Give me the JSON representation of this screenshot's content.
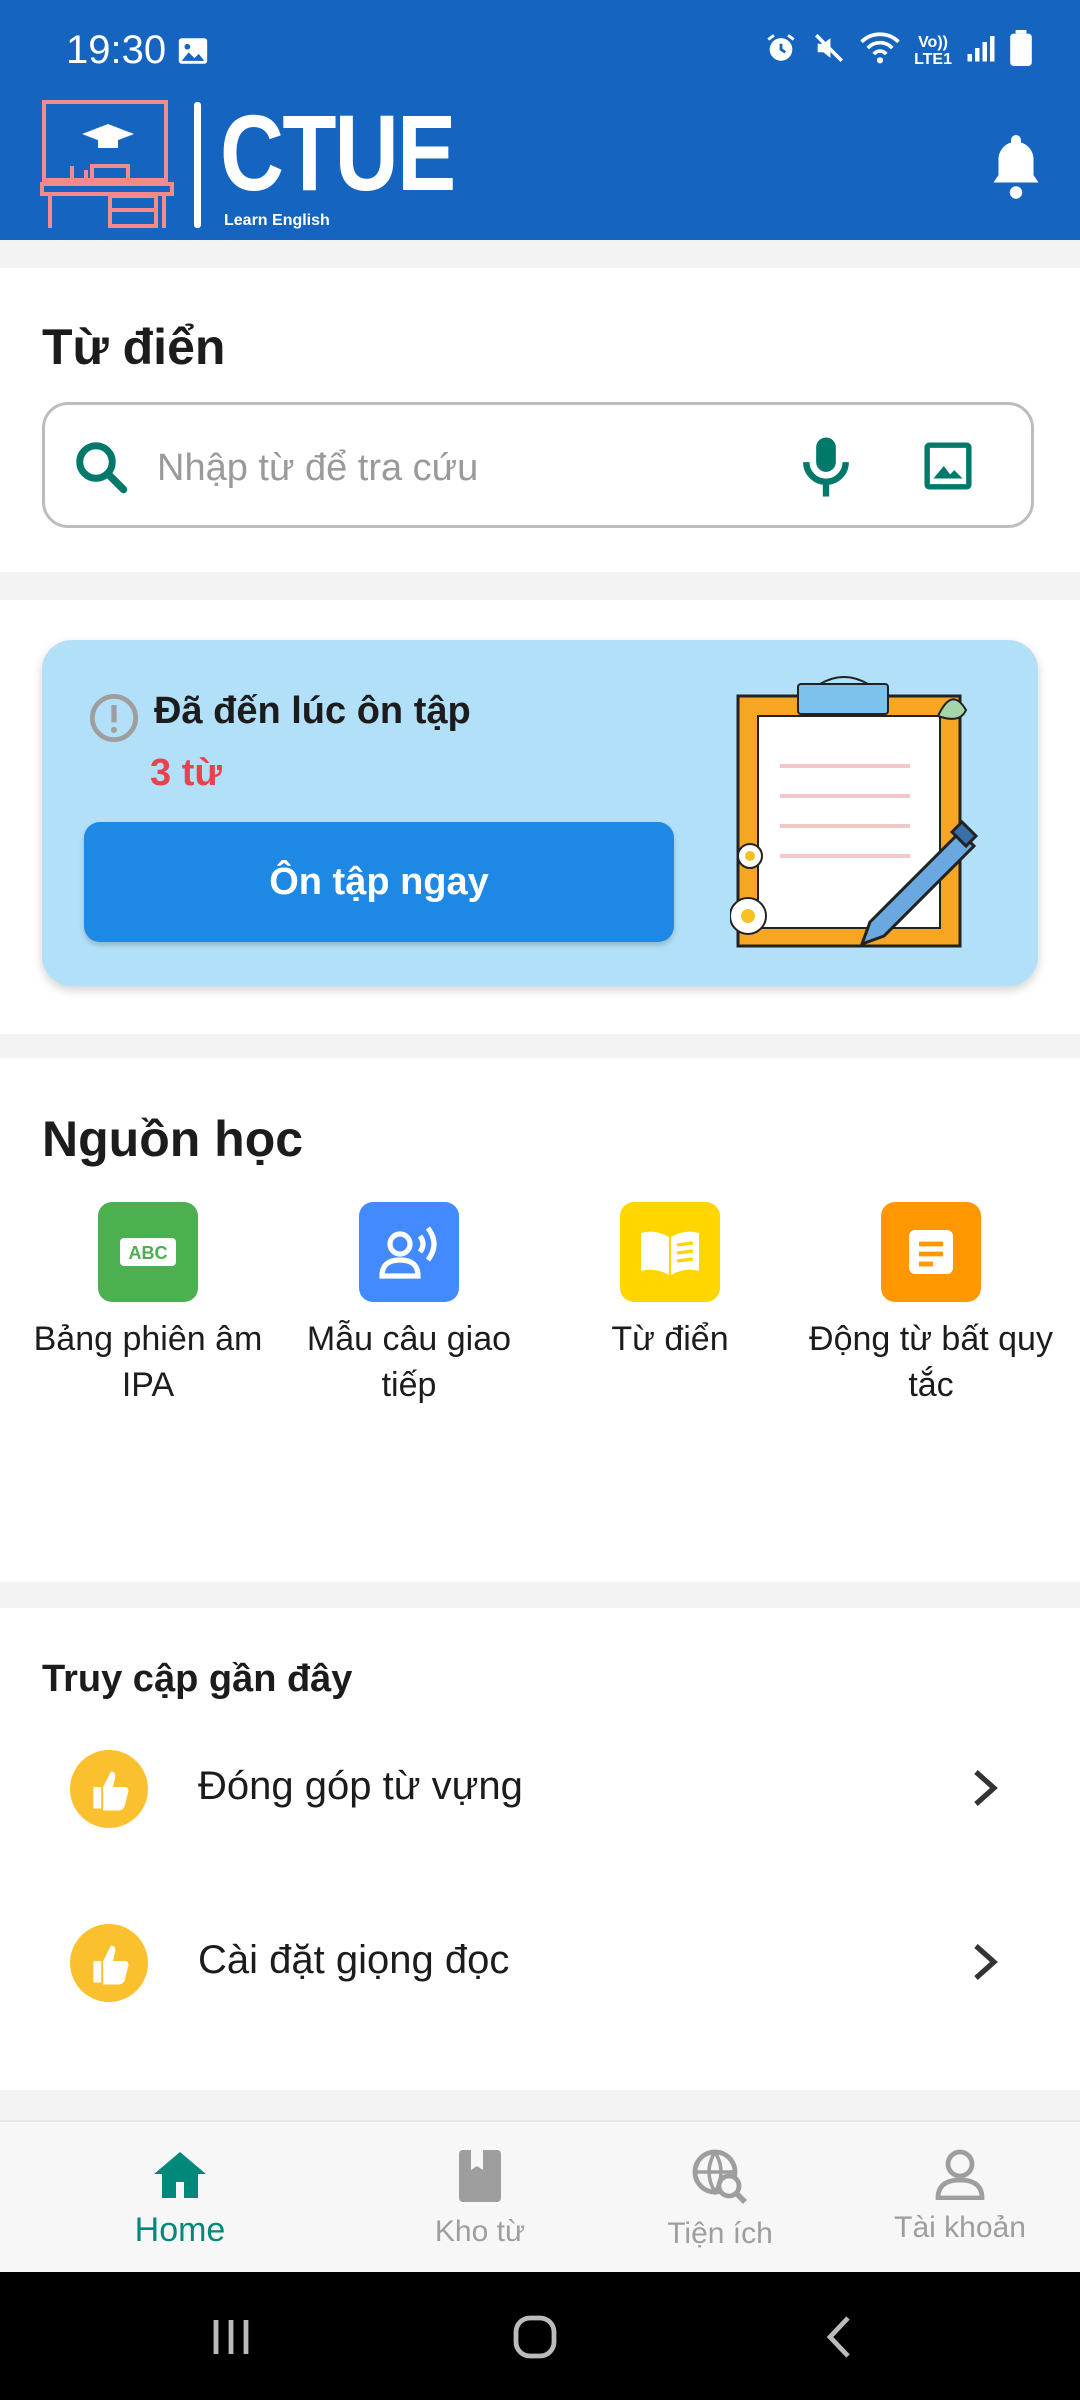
{
  "status_bar": {
    "time": "19:30",
    "network_label": "Vo))\nLTE1"
  },
  "header": {
    "logo_text": "CTUE",
    "logo_subtitle": "Learn English",
    "bell_icon": "bell-icon"
  },
  "dictionary": {
    "title": "Từ điển",
    "search_placeholder": "Nhập từ để tra cứu"
  },
  "review": {
    "title": "Đã đến lúc ôn tập",
    "count": "3 từ",
    "button_label": "Ôn tập ngay"
  },
  "resources": {
    "title": "Nguồn học",
    "items": [
      {
        "label": "Bảng phiên âm IPA",
        "icon": "abc-icon",
        "color": "#4caf50"
      },
      {
        "label": "Mẫu câu giao tiếp",
        "icon": "speaking-icon",
        "color": "#448aff"
      },
      {
        "label": "Từ điển",
        "icon": "book-icon",
        "color": "#ffd600"
      },
      {
        "label": "Động từ bất quy tắc",
        "icon": "document-icon",
        "color": "#ff9800"
      }
    ]
  },
  "recent": {
    "title": "Truy cập gần đây",
    "items": [
      {
        "label": "Đóng góp từ vựng"
      },
      {
        "label": "Cài đặt giọng đọc"
      }
    ]
  },
  "bottom_nav": {
    "items": [
      {
        "label": "Home",
        "icon": "home-icon",
        "active": true
      },
      {
        "label": "Kho từ",
        "icon": "bookmark-book-icon",
        "active": false
      },
      {
        "label": "Tiện ích",
        "icon": "globe-search-icon",
        "active": false
      },
      {
        "label": "Tài khoản",
        "icon": "person-icon",
        "active": false
      }
    ]
  },
  "colors": {
    "header_blue": "#1565c0",
    "accent_teal": "#00897b",
    "review_bg": "#b3e0f9",
    "button_blue": "#1e88e5",
    "count_red": "#e8434d"
  }
}
